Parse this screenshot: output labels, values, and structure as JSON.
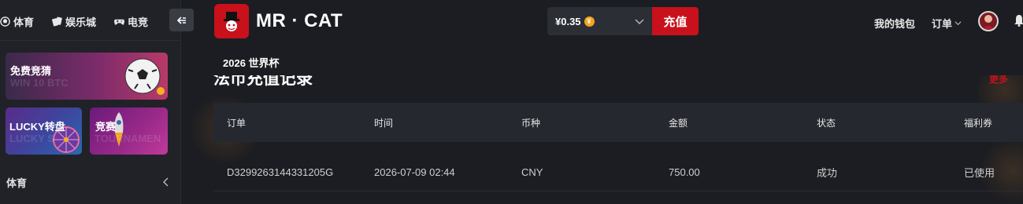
{
  "sidebar": {
    "tabs": [
      {
        "label": "体育",
        "icon": "ball-icon"
      },
      {
        "label": "娱乐城",
        "icon": "cards-icon"
      },
      {
        "label": "电竞",
        "icon": "gamepad-icon"
      }
    ],
    "promos": {
      "guess": {
        "title": "免费竞猜",
        "ghost": "WIN 10 BTC"
      },
      "lucky": {
        "title": "LUCKY转盘",
        "ghost": "LUCKY S"
      },
      "contest": {
        "title": "竞赛",
        "ghost": "TOURNAMEN"
      }
    },
    "section": {
      "label": "体育"
    }
  },
  "header": {
    "brand": "MR · CAT",
    "balance": "¥0.35",
    "coin_symbol": "¥",
    "deposit_label": "充值",
    "wallet_label": "我的钱包",
    "orders_label": "订单",
    "nav_item": "2026 世界杯"
  },
  "page": {
    "title": "法币充值记录",
    "more_label": "更多"
  },
  "table": {
    "columns": [
      "订单",
      "时间",
      "币种",
      "金额",
      "状态",
      "福利券"
    ],
    "rows": [
      {
        "order": "D3299263144331205G",
        "time": "2026-07-09 02:44",
        "currency": "CNY",
        "amount": "750.00",
        "status": "成功",
        "coupon": "已使用"
      }
    ]
  },
  "colors": {
    "accent": "#c8111b",
    "background": "#1b1d22",
    "sidebar": "#202228",
    "table_head": "#26282f"
  }
}
